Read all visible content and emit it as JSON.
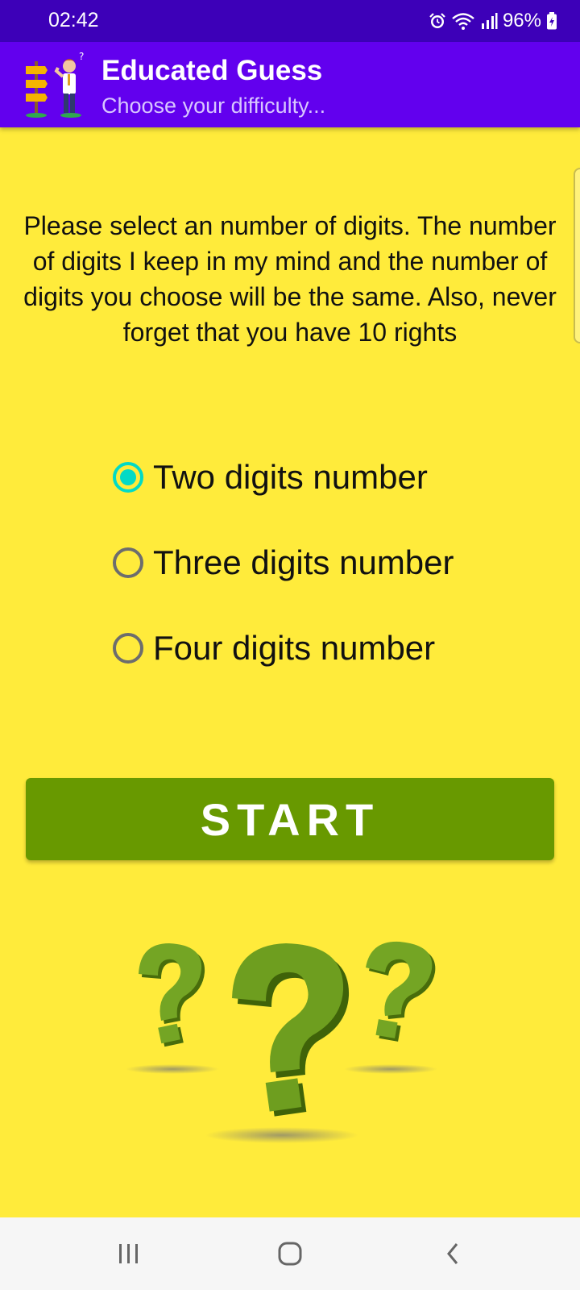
{
  "status_bar": {
    "time": "02:42",
    "battery": "96%",
    "icons": [
      "alarm-icon",
      "wifi-icon",
      "signal-icon",
      "battery-charging-icon"
    ]
  },
  "app_bar": {
    "title": "Educated Guess",
    "subtitle": "Choose your difficulty...",
    "background": "#6200EE"
  },
  "main": {
    "background": "#FFEB3B",
    "instructions": "Please select an number of digits. The number of digits I keep in my mind and the number of digits you choose will be the same. Also, never forget that you have 10 rights",
    "options": [
      {
        "label": "Two digits number",
        "checked": true
      },
      {
        "label": "Three digits number",
        "checked": false
      },
      {
        "label": "Four digits number",
        "checked": false
      }
    ],
    "start_label": "START",
    "start_color": "#689900",
    "accent": "#03DAC5"
  },
  "nav_bar": {
    "buttons": [
      "recent-apps-icon",
      "home-icon",
      "back-icon"
    ]
  }
}
